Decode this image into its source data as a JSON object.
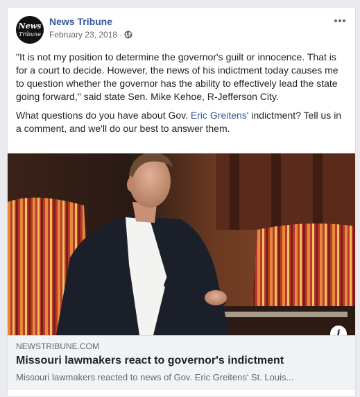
{
  "post": {
    "page_name": "News Tribune",
    "avatar_text_top": "News",
    "avatar_text_bottom": "Tribune",
    "date": "February 23, 2018",
    "separator": "·",
    "paragraph1": "\"It is not my position to determine the governor's guilt or innocence. That is for a court to decide. However, the news of his indictment today causes me to question whether the governor has the ability to effectively lead the state going forward,\" said state Sen. Mike Kehoe, R-Jefferson City.",
    "paragraph2_before": "What questions do you have about Gov. ",
    "paragraph2_link": "Eric Greitens",
    "paragraph2_after": "' indictment? Tell us in a comment, and we'll do our best to answer them."
  },
  "preview": {
    "info_label": "i",
    "domain": "NEWSTRIBUNE.COM",
    "headline": "Missouri lawmakers react to governor's indictment",
    "description": "Missouri lawmakers reacted to news of Gov. Eric Greitens' St. Louis..."
  },
  "colors": {
    "link": "#365899",
    "meta": "#616770",
    "preview_bg": "#f2f3f5"
  },
  "icons": {
    "globe": "globe-icon",
    "more": "more-options-icon",
    "info": "info-icon"
  }
}
